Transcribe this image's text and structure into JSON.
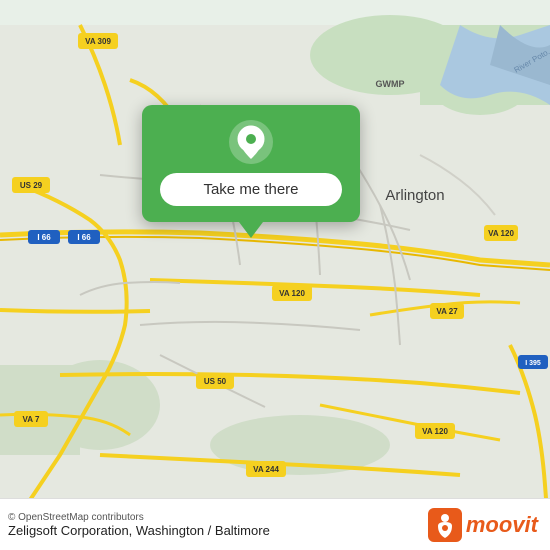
{
  "map": {
    "background_color": "#eaeaea",
    "center": "Arlington, Virginia area"
  },
  "popup": {
    "button_label": "Take me there",
    "background_color": "#4CAF50"
  },
  "bottom_bar": {
    "osm_credit": "© OpenStreetMap contributors",
    "app_name": "Zeligsoft Corporation, Washington / Baltimore",
    "moovit_text": "moovit"
  },
  "icons": {
    "pin": "location-pin-icon",
    "moovit_logo": "moovit-logo-icon"
  }
}
